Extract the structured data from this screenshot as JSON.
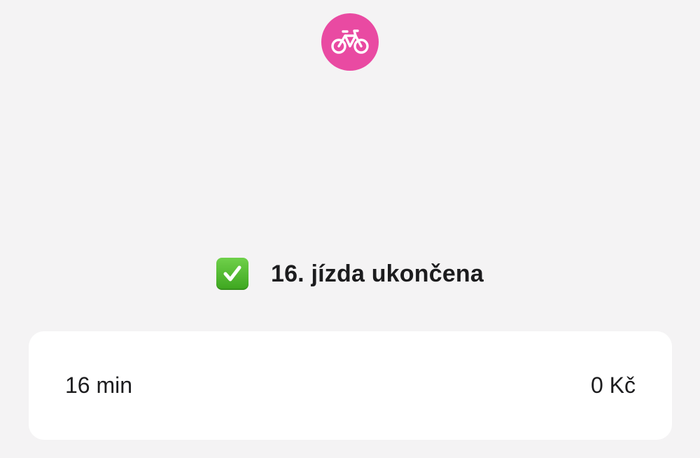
{
  "logo": {
    "icon": "bicycle-icon",
    "background_color": "#e94aa2"
  },
  "headline": {
    "icon": "check-mark-icon",
    "text": "16. jízda ukončena"
  },
  "summary": {
    "duration": "16 min",
    "price": "0 Kč"
  }
}
